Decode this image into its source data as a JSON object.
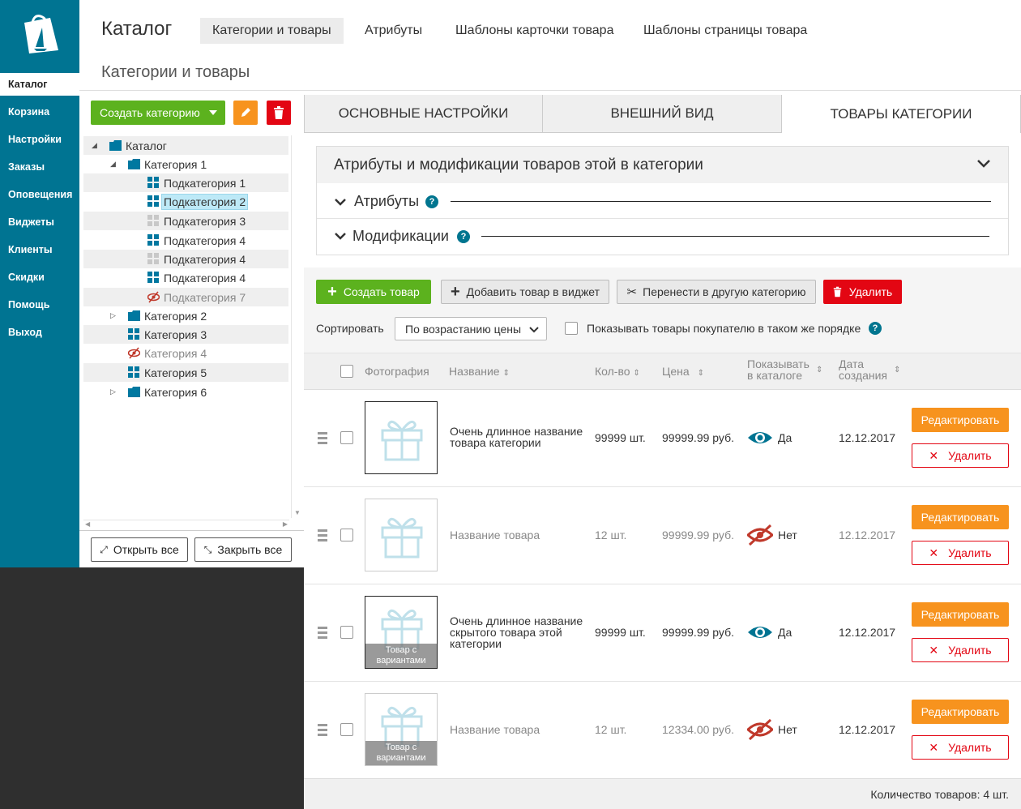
{
  "sidebar": {
    "items": [
      {
        "label": "Каталог",
        "active": true
      },
      {
        "label": "Корзина"
      },
      {
        "label": "Настройки"
      },
      {
        "label": "Заказы"
      },
      {
        "label": "Оповещения"
      },
      {
        "label": "Виджеты"
      },
      {
        "label": "Клиенты"
      },
      {
        "label": "Скидки"
      },
      {
        "label": "Помощь"
      },
      {
        "label": "Выход"
      }
    ]
  },
  "header": {
    "title": "Каталог",
    "tabs": [
      {
        "label": "Категории и товары",
        "active": true
      },
      {
        "label": "Атрибуты"
      },
      {
        "label": "Шаблоны карточки товара"
      },
      {
        "label": "Шаблоны страницы товара"
      }
    ],
    "subtitle": "Категории и товары"
  },
  "left_panel": {
    "create_category_label": "Создать категорию",
    "open_all_label": "Открыть все",
    "close_all_label": "Закрыть все",
    "tree": [
      {
        "label": "Каталог",
        "icon": "folder-icon"
      },
      {
        "label": "Категория 1",
        "icon": "folder-icon"
      },
      {
        "label": "Подкатегория 1",
        "icon": "grid-icon"
      },
      {
        "label": "Подкатегория 2",
        "icon": "grid-icon",
        "selected": true
      },
      {
        "label": "Подкатегория 3",
        "icon": "grid-gray-icon"
      },
      {
        "label": "Подкатегория 4",
        "icon": "grid-icon"
      },
      {
        "label": "Подкатегория 4",
        "icon": "grid-gray-icon"
      },
      {
        "label": "Подкатегория 4",
        "icon": "grid-icon"
      },
      {
        "label": "Подкатегория 7",
        "icon": "hidden-eye-icon",
        "hidden": true
      },
      {
        "label": "Категория 2",
        "icon": "folder-icon"
      },
      {
        "label": "Категория 3",
        "icon": "grid-icon"
      },
      {
        "label": "Категория 4",
        "icon": "hidden-eye-icon",
        "hidden": true
      },
      {
        "label": "Категория 5",
        "icon": "grid-icon"
      },
      {
        "label": "Категория 6",
        "icon": "folder-icon"
      }
    ]
  },
  "panel_tabs": [
    {
      "label": "ОСНОВНЫЕ НАСТРОЙКИ"
    },
    {
      "label": "ВНЕШНИЙ ВИД"
    },
    {
      "label": "ТОВАРЫ КАТЕГОРИИ",
      "active": true
    }
  ],
  "attributes_section": {
    "title": "Атрибуты  и модификации товаров этой в категории",
    "attributes_label": "Атрибуты",
    "modifications_label": "Модификации",
    "help_glyph": "?"
  },
  "toolbar": {
    "create_product": "Создать товар",
    "add_to_widget": "Добавить товар в виджет",
    "move_category": "Перенести в другую категорию",
    "delete": "Удалить",
    "sort_label": "Сортировать",
    "sort_value": "По возрастанию цены",
    "same_order_label": "Показывать товары покупателю в таком же порядке"
  },
  "table": {
    "headers": {
      "photo": "Фотография",
      "name": "Название",
      "qty": "Кол-во",
      "price": "Цена",
      "show_line1": "Показывать",
      "show_line2": "в каталоге",
      "date_line1": "Дата",
      "date_line2": "создания"
    },
    "edit_label": "Редактировать",
    "delete_label": "Удалить",
    "variant_line1": "Товар с",
    "variant_line2": "вариантами",
    "rows": [
      {
        "name": "Очень длинное название товара категории",
        "qty": "99999 шт.",
        "price": "99999.99 руб.",
        "shown": "Да",
        "date": "12.12.2017",
        "visible": true,
        "variants": false
      },
      {
        "name": "Название товара",
        "qty": "12 шт.",
        "price": "99999.99 руб.",
        "shown": "Нет",
        "date": "12.12.2017",
        "visible": false,
        "variants": false
      },
      {
        "name": "Очень длинное название скрытого товара этой категории",
        "qty": "99999 шт.",
        "price": "99999.99 руб.",
        "shown": "Да",
        "date": "12.12.2017",
        "visible": true,
        "variants": true
      },
      {
        "name": "Название товара",
        "qty": "12 шт.",
        "price": "12334.00 руб.",
        "shown": "Нет",
        "date": "12.12.2017",
        "visible": false,
        "variants": true
      }
    ]
  },
  "footer": {
    "count_text": "Количество товаров: 4 шт."
  },
  "colors": {
    "sidebar": "#007492",
    "green": "#5cb21e",
    "orange": "#f7931e",
    "red": "#e30613",
    "accent": "#00758f"
  }
}
